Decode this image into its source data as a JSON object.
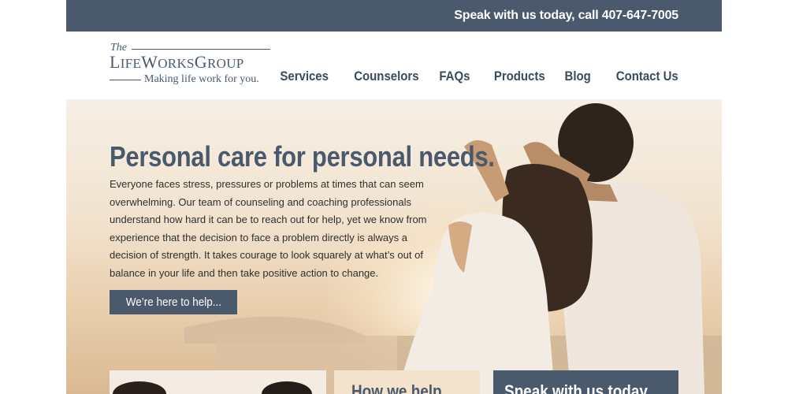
{
  "topbar": {
    "phone_text": "Speak with us today, call 407-647-7005"
  },
  "logo": {
    "the": "The",
    "name_l": "L",
    "name_ife": "IFE",
    "name_w": "W",
    "name_orks": "ORKS",
    "name_g": "G",
    "name_roup": "ROUP",
    "tagline": "Making life work for you."
  },
  "nav": {
    "items": [
      {
        "label": "Services"
      },
      {
        "label": "Counselors"
      },
      {
        "label": "FAQs"
      },
      {
        "label": "Products"
      },
      {
        "label": "Blog"
      },
      {
        "label": "Contact Us"
      }
    ]
  },
  "hero": {
    "title": "Personal care for personal needs.",
    "body": "Everyone faces stress, pressures or problems at times that can seem overwhelming. Our team of counseling and coaching professionals understand how hard it can be to reach out for help, yet we know from experience that the decision to face a problem directly is always a decision of strength. It takes courage to look squarely at what’s out of balance in your life and then take positive action to change.",
    "button_label": "We’re here to help..."
  },
  "cards": {
    "help_title": "How we help",
    "speak_title": "Speak with us today"
  },
  "colors": {
    "brand": "#4a5a6c",
    "hero_background": "#f2e3cf"
  }
}
